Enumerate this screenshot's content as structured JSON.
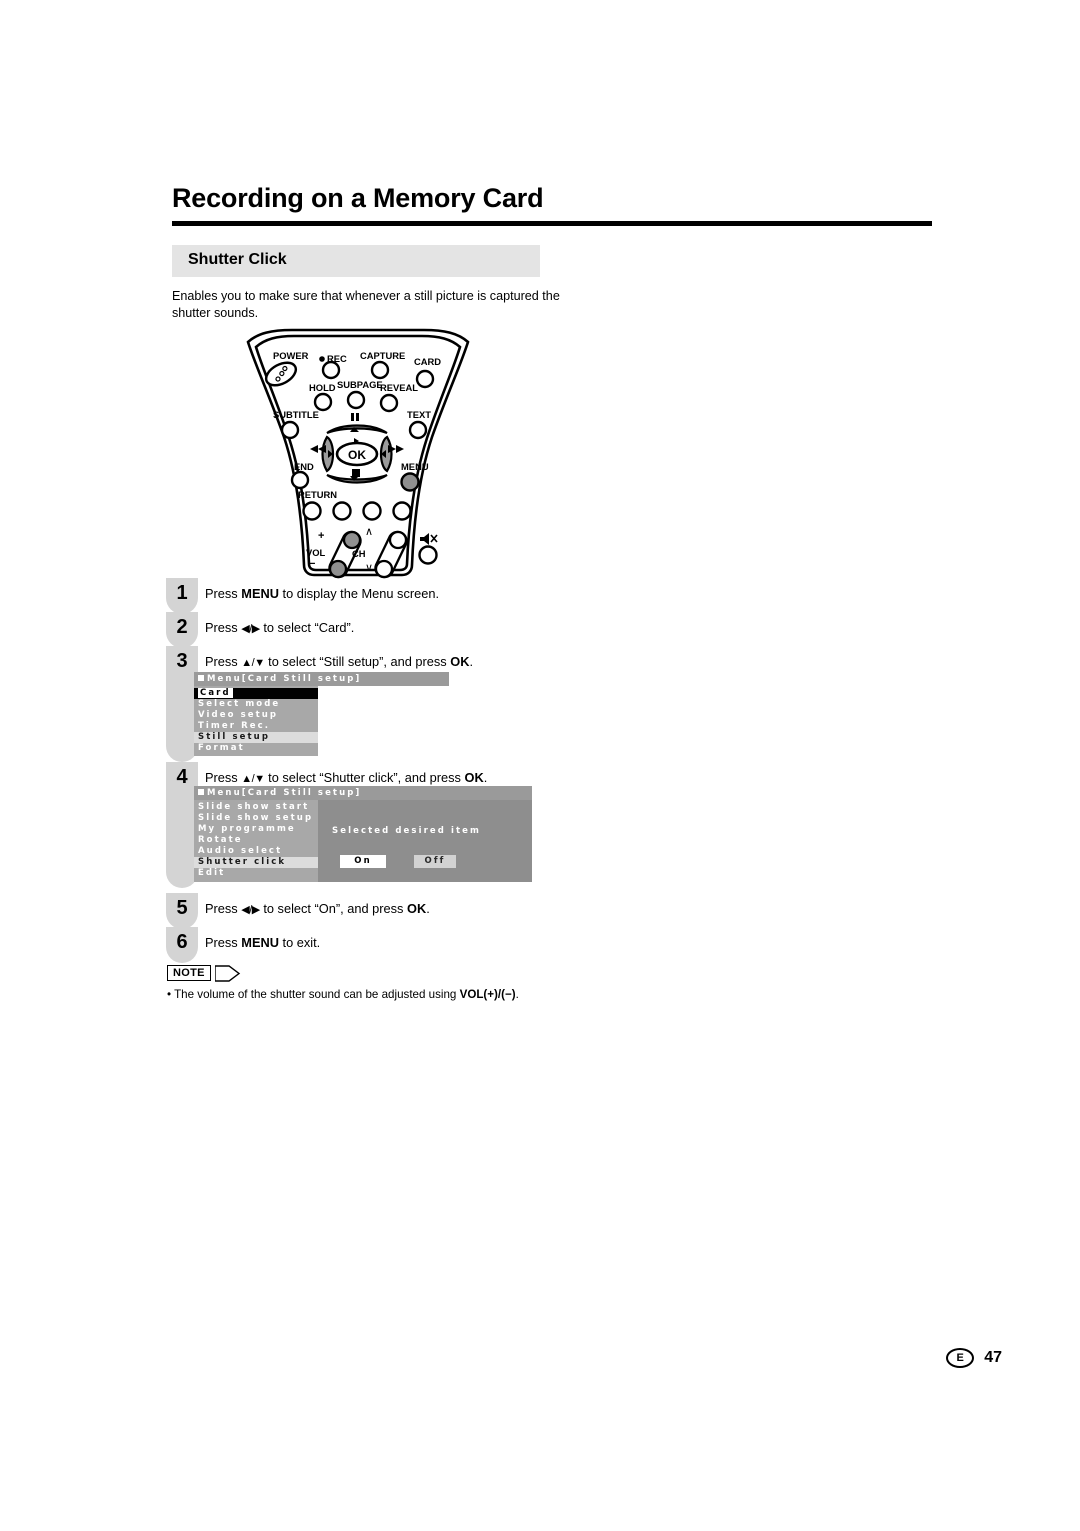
{
  "document": {
    "title": "Recording on a Memory Card",
    "section_heading": "Shutter Click",
    "intro": "Enables you to make sure that whenever a still picture is captured the shutter sounds."
  },
  "remote": {
    "labels": {
      "power": "POWER",
      "rec": "REC",
      "capture": "CAPTURE",
      "card": "CARD",
      "hold": "HOLD",
      "subpage": "SUBPAGE",
      "reveal": "REVEAL",
      "subtitle": "SUBTITLE",
      "text": "TEXT",
      "end": "END",
      "menu": "MENU",
      "return": "RETURN",
      "ok": "OK",
      "vol": "VOL",
      "ch": "CH",
      "vol_plus": "+",
      "vol_minus": "−"
    }
  },
  "steps": [
    {
      "num": "1",
      "html": "Press <b>MENU</b> to display the Menu screen."
    },
    {
      "num": "2",
      "html": "Press <span class=\"arrowglyph\">◀/▶</span> to select “Card”."
    },
    {
      "num": "3",
      "html": "Press <span class=\"arrowglyph\">▲/▼</span> to select “Still setup”, and press <b>OK</b>."
    },
    {
      "num": "4",
      "html": "Press <span class=\"arrowglyph\">▲/▼</span> to select “Shutter click”, and press <b>OK</b>."
    },
    {
      "num": "5",
      "html": "Press <span class=\"arrowglyph\">◀/▶</span> to select “On”, and press <b>OK</b>."
    },
    {
      "num": "6",
      "html": "Press <b>MENU</b> to exit."
    }
  ],
  "osd_card": {
    "title": "Menu[Card  Still  setup]",
    "header_row": "Card",
    "items": [
      {
        "label": "Select  mode",
        "state": "normal"
      },
      {
        "label": "Video  setup",
        "state": "normal"
      },
      {
        "label": "Timer  Rec.",
        "state": "normal"
      },
      {
        "label": "Still  setup",
        "state": "highlighted"
      },
      {
        "label": "Format",
        "state": "normal"
      }
    ]
  },
  "osd_still": {
    "title": "Menu[Card  Still  setup]",
    "items": [
      {
        "label": "Slide show  start",
        "state": "normal"
      },
      {
        "label": "Slide show  setup",
        "state": "normal"
      },
      {
        "label": "My  programme",
        "state": "normal"
      },
      {
        "label": "Rotate",
        "state": "normal"
      },
      {
        "label": "Audio  select",
        "state": "normal"
      },
      {
        "label": "Shutter  click",
        "state": "highlighted"
      },
      {
        "label": "Edit",
        "state": "normal"
      }
    ],
    "hint": "Selected  desired  item",
    "option_on": "On",
    "option_off": "Off"
  },
  "note": {
    "label": "NOTE",
    "html": "•  The volume of the shutter sound can be adjusted using <b>VOL(+)/(−)</b>."
  },
  "footer": {
    "language": "E",
    "page": "47"
  },
  "colors": {
    "section_bar": "#e4e4e4",
    "step_rail": "#d4d4d4",
    "osd_title_bar": "#9a9a9a",
    "osd_list": "#a8a8a8",
    "osd_panel": "#8e8e8e",
    "osd_highlight": "#dcdcdc"
  }
}
